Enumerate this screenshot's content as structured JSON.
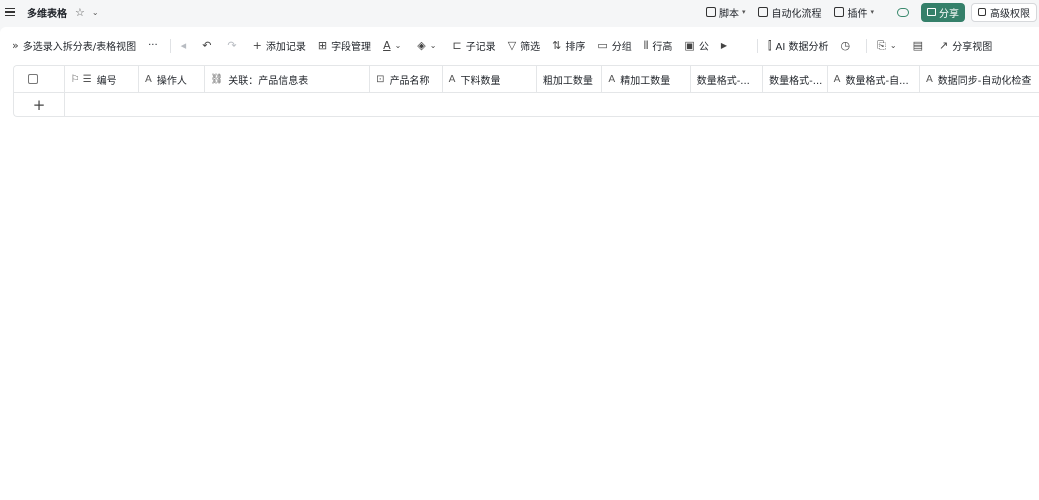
{
  "topbar": {
    "title": "多维表格",
    "script_label": "脚本",
    "automation_label": "自动化流程",
    "plugin_label": "插件",
    "share_label": "分享",
    "permission_label": "高级权限"
  },
  "toolbar": {
    "view_name": "多选录入拆分表/表格视图",
    "more": "···",
    "add_record": "添加记录",
    "field_manage": "字段管理",
    "sub_record": "子记录",
    "filter": "筛选",
    "sort": "排序",
    "group": "分组",
    "row_height": "行高",
    "formula": "公",
    "ai_analysis": "AI 数据分析",
    "share_view": "分享视图"
  },
  "columns": [
    {
      "icon": "⚐ ☰",
      "label": "编号"
    },
    {
      "icon": "A",
      "label": "操作人"
    },
    {
      "icon": "⛓",
      "label": "关联：产品信息表"
    },
    {
      "icon": "⊡",
      "label": "产品名称"
    },
    {
      "icon": "A",
      "label": "下料数量"
    },
    {
      "icon": "",
      "label": "粗加工数量"
    },
    {
      "icon": "A",
      "label": "精加工数量"
    },
    {
      "icon": "",
      "label": "数量格式-..."
    },
    {
      "icon": "",
      "label": "数量格式-..."
    },
    {
      "icon": "A",
      "label": "数量格式-自..."
    },
    {
      "icon": "A",
      "label": "数据同步-自动化检查"
    }
  ],
  "add_row": "+"
}
